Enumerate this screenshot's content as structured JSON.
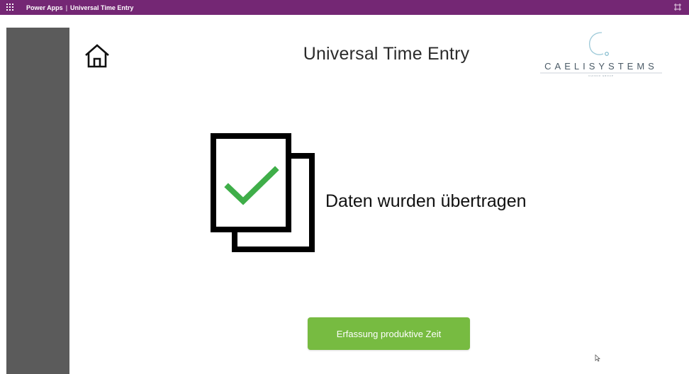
{
  "topbar": {
    "brand": "Power Apps",
    "separator": "|",
    "app_name": "Universal Time Entry"
  },
  "header": {
    "title": "Universal Time Entry",
    "logo_text": "CAELISYSTEMS",
    "logo_subtext": "CHINCO GROUP"
  },
  "main": {
    "message": "Daten wurden übertragen"
  },
  "actions": {
    "button_label": "Erfassung produktive Zeit"
  },
  "icons": {
    "waffle": "app-launcher-icon",
    "expand": "fullscreen-icon",
    "home": "home-icon",
    "success": "document-checkmark-icon"
  },
  "colors": {
    "topbar": "#742774",
    "sidebar": "#5b5b5b",
    "button": "#77bb41",
    "checkmark": "#3fae49"
  }
}
